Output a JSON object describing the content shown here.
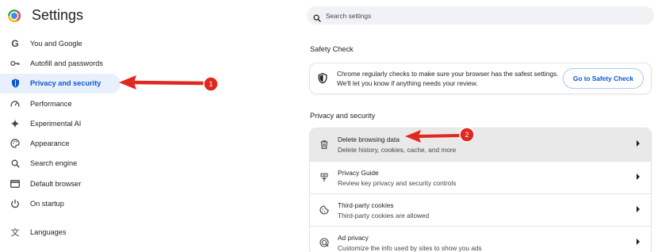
{
  "header": {
    "title": "Settings",
    "logo_icon": "chrome-logo-icon"
  },
  "sidebar": {
    "items": [
      {
        "label": "You and Google",
        "icon": "google-g-icon"
      },
      {
        "label": "Autofill and passwords",
        "icon": "key-icon"
      },
      {
        "label": "Privacy and security",
        "icon": "shield-icon",
        "active": true
      },
      {
        "label": "Performance",
        "icon": "speedometer-icon"
      },
      {
        "label": "Experimental AI",
        "icon": "sparkle-icon"
      },
      {
        "label": "Appearance",
        "icon": "palette-icon"
      },
      {
        "label": "Search engine",
        "icon": "search-icon"
      },
      {
        "label": "Default browser",
        "icon": "browser-window-icon"
      },
      {
        "label": "On startup",
        "icon": "power-icon"
      },
      {
        "label": "Languages",
        "icon": "translate-icon"
      }
    ]
  },
  "search": {
    "placeholder": "Search settings"
  },
  "safety_check": {
    "section_title": "Safety Check",
    "line1": "Chrome regularly checks to make sure your browser has the safest settings.",
    "line2": "We'll let you know if anything needs your review.",
    "button_label": "Go to Safety Check"
  },
  "privacy": {
    "section_title": "Privacy and security",
    "rows": [
      {
        "title": "Delete browsing data",
        "subtitle": "Delete history, cookies, cache, and more",
        "icon": "trash-icon"
      },
      {
        "title": "Privacy Guide",
        "subtitle": "Review key privacy and security controls",
        "icon": "privacy-guide-icon"
      },
      {
        "title": "Third-party cookies",
        "subtitle": "Third-party cookies are allowed",
        "icon": "cookie-icon"
      },
      {
        "title": "Ad privacy",
        "subtitle": "Customize the info used by sites to show you ads",
        "icon": "ad-privacy-icon"
      }
    ]
  },
  "annotations": {
    "badge_1": "1",
    "badge_2": "2",
    "color": "#e0281e"
  },
  "colors": {
    "accent": "#0b57d0",
    "active_bg": "#e8f0fe",
    "search_bg": "#f0f2f5",
    "row_highlight": "#e9e9e9"
  }
}
